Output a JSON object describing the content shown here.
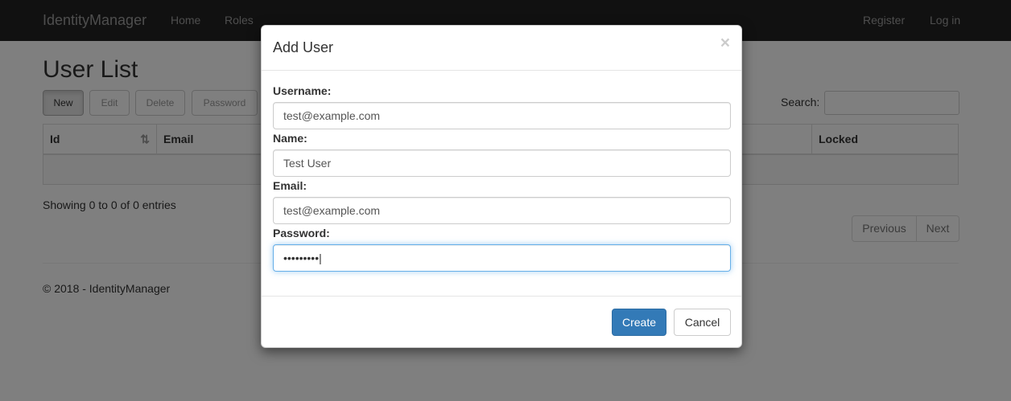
{
  "navbar": {
    "brand": "IdentityManager",
    "links": [
      "Home",
      "Roles"
    ],
    "right_links": [
      "Register",
      "Log in"
    ]
  },
  "page": {
    "title": "User List",
    "toolbar": [
      "New",
      "Edit",
      "Delete",
      "Password"
    ],
    "search_label": "Search:",
    "search_value": "",
    "columns": [
      "Id",
      "Email",
      "Locked"
    ],
    "info": "Showing 0 to 0 of 0 entries",
    "pager": [
      "Previous",
      "Next"
    ],
    "footer": "© 2018 - IdentityManager"
  },
  "modal": {
    "title": "Add User",
    "close": "×",
    "fields": [
      {
        "label": "Username:",
        "value": "test@example.com"
      },
      {
        "label": "Name:",
        "value": "Test User"
      },
      {
        "label": "Email:",
        "value": "test@example.com"
      },
      {
        "label": "Password:",
        "value": "•••••••••|"
      }
    ],
    "create": "Create",
    "cancel": "Cancel"
  },
  "colors": {
    "navbar_bg": "#222222",
    "primary": "#337ab7",
    "focus_border": "#66afe9"
  }
}
